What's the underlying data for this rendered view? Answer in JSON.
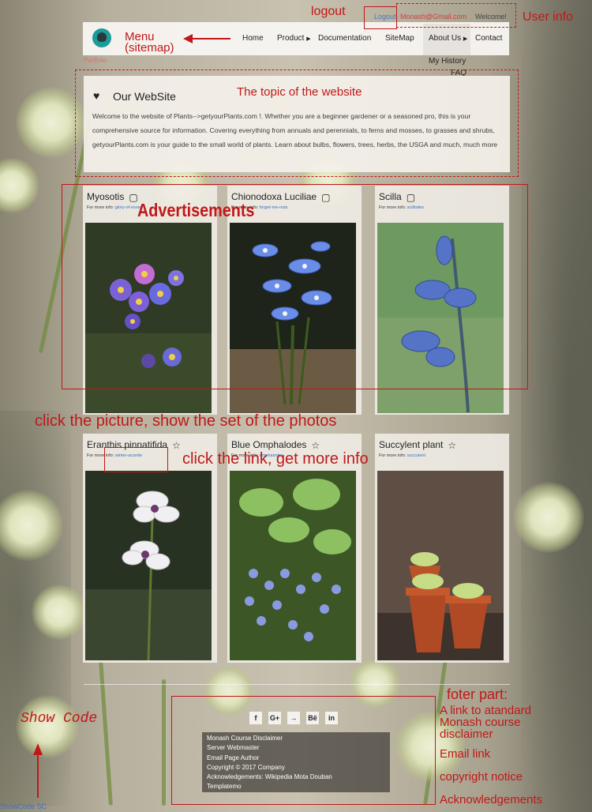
{
  "nav": {
    "items": [
      "Home",
      "Product",
      "Documentation",
      "SiteMap",
      "About Us",
      "Contact"
    ],
    "about_dropdown": [
      "My History",
      "FAQ"
    ],
    "below_label": "Portfolio"
  },
  "user": {
    "logout": "Logout",
    "email": "Monash@Gmail.com",
    "welcome": "Welcome!"
  },
  "site": {
    "title": "Our WebSite",
    "body": "Welcome to the website of Plants-->getyourPlants.com   !. Whether you are a beginner gardener or a seasoned pro,  this is your comprehensive source for information. Covering everything from annuals and perennials, to ferns and mosses, to grasses and shrubs, getyourPlants.com is your guide to the small world of plants. Learn about bulbs, flowers, trees, herbs, the USGA and much, much more"
  },
  "cards": [
    {
      "title": "Myosotis",
      "info_label": "For more info:",
      "link": "glory-of-snow"
    },
    {
      "title": "Chionodoxa Luciliae",
      "info_label": "For more info:",
      "link": "forget-me-nots"
    },
    {
      "title": "Scilla",
      "info_label": "For more info:",
      "link": "scillodes"
    },
    {
      "title": "Eranthis pinnatifida",
      "info_label": "For more info:",
      "link": "winter-aconite"
    },
    {
      "title": "Blue Omphalodes",
      "info_label": "For more info:",
      "link": "omphalodes"
    },
    {
      "title": "Succylent plant",
      "info_label": "For more info:",
      "link": "succulent"
    }
  ],
  "footer": {
    "social": [
      "f",
      "G+",
      "→",
      "Bë",
      "in"
    ],
    "lines": [
      "Monash Course Disclaimer",
      "Server Webmaster",
      "Email Page Author",
      "Copyright © 2017 Company",
      "Acknowledgements: Wikipedia   Mota   Douban",
      "Templatemo"
    ],
    "show_code": "ShowCode SC"
  },
  "annotations": {
    "logout": "logout",
    "user_info": "User info",
    "menu": "Menu",
    "menu_sub": "(sitemap)",
    "topic": "The topic of  the website",
    "ads": "Advertisements",
    "click_picture": "click the picture, show the set of the photos",
    "click_link": "click the link, get more info",
    "footer_title": "foter part:",
    "footer_notes": [
      "A link to atandard",
      "Monash course",
      "disclaimer",
      "Email link",
      "copyright notice",
      "Acknowledgements"
    ],
    "show_code": "Show Code"
  },
  "colors": {
    "annotation": "#c01818",
    "link": "#2f6fc0"
  }
}
